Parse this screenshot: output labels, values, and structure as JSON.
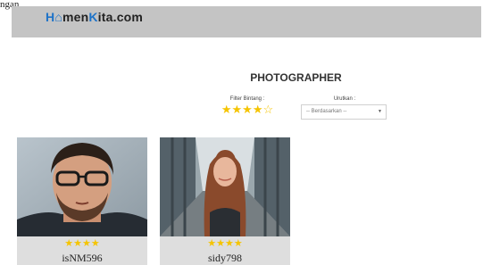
{
  "figure_label": "ngan",
  "header": {
    "logo": {
      "part1": "H",
      "part2": "men",
      "part3": "K",
      "part4": "ita.com"
    }
  },
  "page": {
    "title": "PHOTOGRAPHER"
  },
  "filter": {
    "label": "Filter Bintang :",
    "rating": 4,
    "max": 5
  },
  "sort": {
    "label": "Urutkan :",
    "selected": "-- Berdasarkan --"
  },
  "photographers": [
    {
      "name": "isNM596",
      "rating": 4
    },
    {
      "name": "sidy798",
      "rating": 4
    }
  ],
  "colors": {
    "header_bg": "#c4c4c4",
    "star": "#f5c400",
    "brand_blue": "#1e73c8"
  }
}
